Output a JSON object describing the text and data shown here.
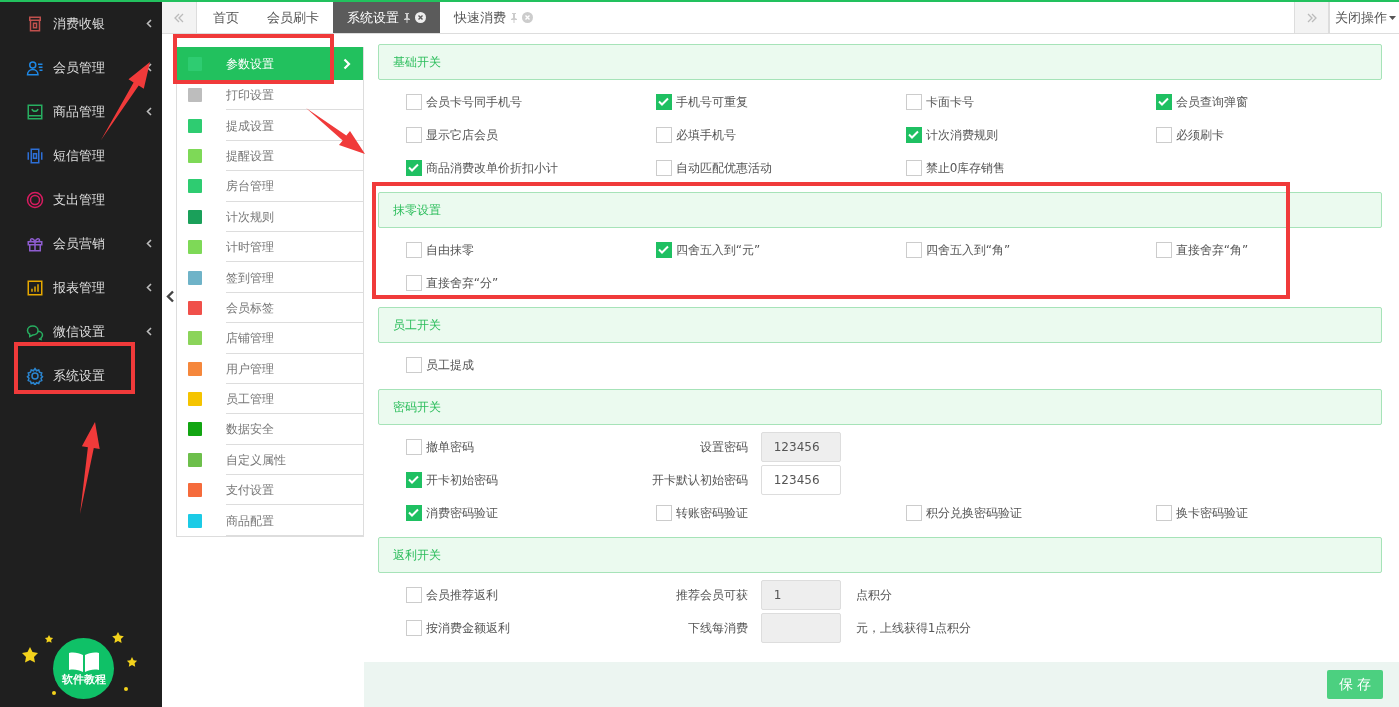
{
  "sidebar": {
    "items": [
      {
        "label": "消费收银",
        "color": "#c0504d",
        "has_children": true,
        "highlighted": false
      },
      {
        "label": "会员管理",
        "color": "#1e88e5",
        "has_children": true,
        "highlighted": false
      },
      {
        "label": "商品管理",
        "color": "#27ae60",
        "has_children": true,
        "highlighted": false
      },
      {
        "label": "短信管理",
        "color": "#2d6fd6",
        "has_children": false,
        "highlighted": false
      },
      {
        "label": "支出管理",
        "color": "#d81b60",
        "has_children": false,
        "highlighted": false
      },
      {
        "label": "会员营销",
        "color": "#8e5ccf",
        "has_children": true,
        "highlighted": false
      },
      {
        "label": "报表管理",
        "color": "#e6a800",
        "has_children": true,
        "highlighted": false
      },
      {
        "label": "微信设置",
        "color": "#27ae60",
        "has_children": true,
        "highlighted": false
      },
      {
        "label": "系统设置",
        "color": "#2b86d1",
        "has_children": false,
        "highlighted": true
      }
    ],
    "tutorial": {
      "label": "软件教程"
    }
  },
  "tabs": [
    {
      "label": "首页",
      "selected": false,
      "closable": false
    },
    {
      "label": "会员刷卡",
      "selected": false,
      "closable": false
    },
    {
      "label": "系统设置",
      "selected": true,
      "closable": true
    },
    {
      "label": "快速消费",
      "selected": false,
      "closable": true
    }
  ],
  "close_menu": {
    "label": "关闭操作"
  },
  "submenu": {
    "items": [
      {
        "label": "参数设置",
        "color": "#2ecc71",
        "selected": true,
        "highlighted": true
      },
      {
        "label": "打印设置",
        "color": "#bdbdbd",
        "selected": false,
        "highlighted": false
      },
      {
        "label": "提成设置",
        "color": "#2ecc71",
        "selected": false,
        "highlighted": false
      },
      {
        "label": "提醒设置",
        "color": "#7ed957",
        "selected": false,
        "highlighted": false
      },
      {
        "label": "房台管理",
        "color": "#2ecc71",
        "selected": false,
        "highlighted": false
      },
      {
        "label": "计次规则",
        "color": "#1aa05a",
        "selected": false,
        "highlighted": false
      },
      {
        "label": "计时管理",
        "color": "#7ed957",
        "selected": false,
        "highlighted": false
      },
      {
        "label": "签到管理",
        "color": "#6fb3c8",
        "selected": false,
        "highlighted": false
      },
      {
        "label": "会员标签",
        "color": "#f0504a",
        "selected": false,
        "highlighted": false
      },
      {
        "label": "店铺管理",
        "color": "#8bd45a",
        "selected": false,
        "highlighted": false
      },
      {
        "label": "用户管理",
        "color": "#f5873c",
        "selected": false,
        "highlighted": false
      },
      {
        "label": "员工管理",
        "color": "#f5c400",
        "selected": false,
        "highlighted": false
      },
      {
        "label": "数据安全",
        "color": "#12a512",
        "selected": false,
        "highlighted": false
      },
      {
        "label": "自定义属性",
        "color": "#6dbf4b",
        "selected": false,
        "highlighted": false
      },
      {
        "label": "支付设置",
        "color": "#f56b3c",
        "selected": false,
        "highlighted": false
      },
      {
        "label": "商品配置",
        "color": "#1ccbe6",
        "selected": false,
        "highlighted": false
      }
    ]
  },
  "sections": [
    {
      "title": "基础开关",
      "highlighted": false,
      "rows": [
        [
          {
            "kind": "checkbox",
            "label": "会员卡号同手机号",
            "checked": false
          },
          {
            "kind": "checkbox",
            "label": "手机号可重复",
            "checked": true
          },
          {
            "kind": "checkbox",
            "label": "卡面卡号",
            "checked": false
          },
          {
            "kind": "checkbox",
            "label": "会员查询弹窗",
            "checked": true
          }
        ],
        [
          {
            "kind": "checkbox",
            "label": "显示它店会员",
            "checked": false
          },
          {
            "kind": "checkbox",
            "label": "必填手机号",
            "checked": false
          },
          {
            "kind": "checkbox",
            "label": "计次消费规则",
            "checked": true
          },
          {
            "kind": "checkbox",
            "label": "必须刷卡",
            "checked": false
          }
        ],
        [
          {
            "kind": "checkbox",
            "label": "商品消费改单价折扣小计",
            "checked": true
          },
          {
            "kind": "checkbox",
            "label": "自动匹配优惠活动",
            "checked": false
          },
          {
            "kind": "checkbox",
            "label": "禁止0库存销售",
            "checked": false
          }
        ]
      ]
    },
    {
      "title": "抹零设置",
      "highlighted": true,
      "rows": [
        [
          {
            "kind": "checkbox",
            "label": "自由抹零",
            "checked": false
          },
          {
            "kind": "checkbox",
            "label": "四舍五入到“元”",
            "checked": true
          },
          {
            "kind": "checkbox",
            "label": "四舍五入到“角”",
            "checked": false
          },
          {
            "kind": "checkbox",
            "label": "直接舍弃“角”",
            "checked": false
          }
        ],
        [
          {
            "kind": "checkbox",
            "label": "直接舍弃“分”",
            "checked": false
          }
        ]
      ]
    },
    {
      "title": "员工开关",
      "highlighted": false,
      "rows": [
        [
          {
            "kind": "checkbox",
            "label": "员工提成",
            "checked": false
          }
        ]
      ]
    },
    {
      "title": "密码开关",
      "highlighted": false,
      "rows": [
        [
          {
            "kind": "checkbox",
            "label": "撤单密码",
            "checked": false
          },
          {
            "kind": "field",
            "label": "设置密码",
            "value": "123456",
            "disabled": true
          }
        ],
        [
          {
            "kind": "checkbox",
            "label": "开卡初始密码",
            "checked": true
          },
          {
            "kind": "field",
            "label": "开卡默认初始密码",
            "value": "123456",
            "disabled": false
          }
        ],
        [
          {
            "kind": "checkbox",
            "label": "消费密码验证",
            "checked": true
          },
          {
            "kind": "checkbox",
            "label": "转账密码验证",
            "checked": false
          },
          {
            "kind": "checkbox",
            "label": "积分兑换密码验证",
            "checked": false
          },
          {
            "kind": "checkbox",
            "label": "换卡密码验证",
            "checked": false
          }
        ]
      ]
    },
    {
      "title": "返利开关",
      "highlighted": false,
      "rows": [
        [
          {
            "kind": "checkbox",
            "label": "会员推荐返利",
            "checked": false
          },
          {
            "kind": "field",
            "label": "推荐会员可获",
            "value": "1",
            "disabled": true,
            "suffix": "点积分"
          }
        ],
        [
          {
            "kind": "checkbox",
            "label": "按消费金额返利",
            "checked": false
          },
          {
            "kind": "field",
            "label": "下线每消费",
            "disabled": true,
            "suffix": "元，上线获得1点积分"
          }
        ]
      ]
    }
  ],
  "save_button": {
    "label": "保 存"
  }
}
